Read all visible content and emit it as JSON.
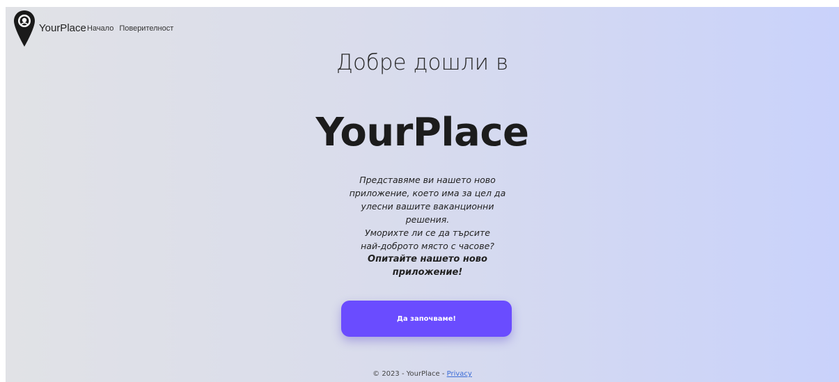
{
  "navbar": {
    "brand": "YourPlace",
    "logo_icon": "map-pin-icon",
    "links": [
      "Начало",
      "Поверителност"
    ]
  },
  "hero": {
    "welcome": "Добре дошли в",
    "title": "YourPlace",
    "intro_lines": [
      "Представяме ви нашето ново",
      "приложение, което има за цел да",
      "улесни вашите ваканционни",
      "решения.",
      "Уморихте ли се да търсите",
      "най-доброто място с часове?"
    ],
    "cta_text_lines": [
      "Опитайте нашето ново",
      "приложение!"
    ],
    "button_label": "Да започваме!"
  },
  "footer": {
    "copyright": "© 2023 - YourPlace - ",
    "privacy_link": "Privacy"
  },
  "colors": {
    "button": "#6a4cff",
    "gradient_start": "#e1e2e6",
    "gradient_end": "#c9d2fb",
    "link": "#3b6bd6"
  }
}
